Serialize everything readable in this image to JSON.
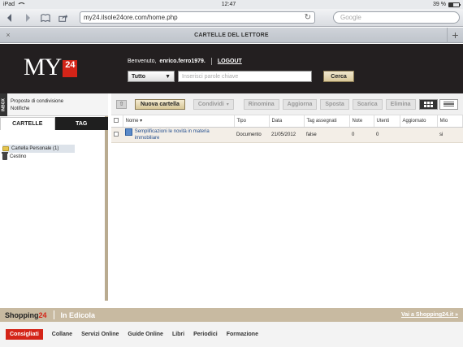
{
  "status_bar": {
    "carrier": "iPad",
    "time": "12:47",
    "battery": "39 %",
    "battery_level": 0.39
  },
  "browser": {
    "url": "my24.ilsole24ore.com/home.php",
    "search_placeholder": "Google",
    "tab_title": "CARTELLE DEL LETTORE",
    "tab_close": "×",
    "tab_add": "+"
  },
  "header": {
    "logo_text": "MY",
    "logo_badge": "24",
    "welcome_prefix": "Benvenuto,",
    "username": "enrico.ferro1979.",
    "logout": "LOGOUT",
    "search_scope": "Tutto",
    "keyword_placeholder": "Inserisci parole chiave",
    "search_button": "Cerca"
  },
  "sidebar": {
    "inbox_label": "INBOX",
    "inbox_links": [
      "Proposte di condivisione",
      "Notifiche"
    ],
    "tabs": [
      "CARTELLE",
      "TAG"
    ],
    "tree": [
      {
        "label": "Cartella Personale (1)",
        "icon": "folder-icon"
      },
      {
        "label": "Cestino",
        "icon": "trash-icon"
      }
    ]
  },
  "toolbar": {
    "new_folder": "Nuova cartella",
    "share": "Condividi",
    "rename": "Rinomina",
    "update": "Aggiorna",
    "move": "Sposta",
    "download": "Scarica",
    "delete": "Elimina"
  },
  "table": {
    "headers": [
      "Nome",
      "Tipo",
      "Data",
      "Tag assegnati",
      "Note",
      "Utenti",
      "Aggiornato",
      "Mio"
    ],
    "rows": [
      {
        "name": "Semplificazioni le novità in materia immobiliare",
        "type": "Documento",
        "date": "21/05/2012",
        "tags": "false",
        "notes": "0",
        "users": "0",
        "updated": "",
        "mine": "si"
      }
    ]
  },
  "footer": {
    "shop_prefix": "Shopping",
    "shop_number": "24",
    "edicola": "In Edicola",
    "shop_link": "Vai a Shopping24.it »",
    "nav": [
      "Consigliati",
      "Collane",
      "Servizi Online",
      "Guide Online",
      "Libri",
      "Periodici",
      "Formazione"
    ]
  }
}
